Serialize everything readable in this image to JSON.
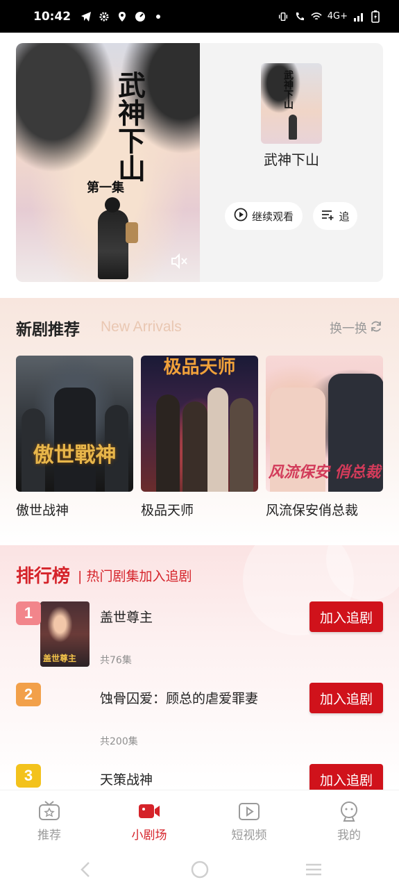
{
  "status_bar": {
    "time": "10:42",
    "network": "4G+"
  },
  "hero": {
    "poster_title": "武神下山",
    "poster_subtitle": "第一集",
    "name": "武神下山",
    "continue_label": "继续观看",
    "follow_label": "追"
  },
  "arrivals": {
    "title": "新剧推荐",
    "subtitle": "New Arrivals",
    "refresh_label": "换一换",
    "items": [
      {
        "name": "傲世战神",
        "poster_text": "傲世戰神"
      },
      {
        "name": "极品天师",
        "poster_text": "极品天师"
      },
      {
        "name": "风流保安俏总裁",
        "poster_text": "风流保安 俏总裁"
      }
    ]
  },
  "ranking": {
    "title": "排行榜",
    "subtitle": "| 热门剧集加入追剧",
    "add_label": "加入追剧",
    "items": [
      {
        "rank": "1",
        "name": "盖世尊主",
        "episodes": "共76集",
        "poster_text": "盖世尊主"
      },
      {
        "rank": "2",
        "name": "蚀骨囚爱：顾总的虐爱罪妻",
        "episodes": "共200集"
      },
      {
        "rank": "3",
        "name": "天策战神",
        "episodes": ""
      }
    ]
  },
  "tabs": [
    {
      "label": "推荐",
      "icon": "tv-icon",
      "active": false
    },
    {
      "label": "小剧场",
      "icon": "video-camera-icon",
      "active": true
    },
    {
      "label": "短视频",
      "icon": "play-box-icon",
      "active": false
    },
    {
      "label": "我的",
      "icon": "profile-icon",
      "active": false
    }
  ],
  "colors": {
    "accent": "#d5232a",
    "add_button": "#d0121b",
    "subtitle_tint": "#e9c7b2"
  }
}
